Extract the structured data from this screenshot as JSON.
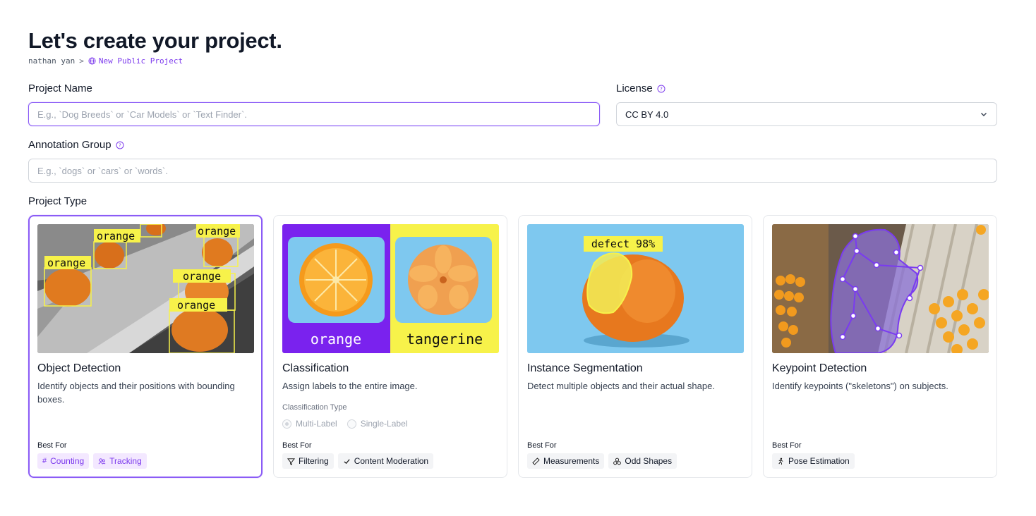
{
  "page": {
    "title": "Let's create your project.",
    "breadcrumb": {
      "user": "nathan yan",
      "separator": ">",
      "project": "New Public Project"
    }
  },
  "form": {
    "project_name": {
      "label": "Project Name",
      "placeholder": "E.g., `Dog Breeds` or `Car Models` or `Text Finder`."
    },
    "license": {
      "label": "License",
      "value": "CC BY 4.0"
    },
    "annotation_group": {
      "label": "Annotation Group",
      "placeholder": "E.g., `dogs` or `cars` or `words`."
    },
    "project_type_label": "Project Type"
  },
  "cards": {
    "object_detection": {
      "title": "Object Detection",
      "desc": "Identify objects and their positions with bounding boxes.",
      "best_for": "Best For",
      "tags": [
        "Counting",
        "Tracking"
      ],
      "img_labels": [
        "orange",
        "orange",
        "orange",
        "orange",
        "orange"
      ]
    },
    "classification": {
      "title": "Classification",
      "desc": "Assign labels to the entire image.",
      "type_label": "Classification Type",
      "options": [
        "Multi-Label",
        "Single-Label"
      ],
      "best_for": "Best For",
      "tags": [
        "Filtering",
        "Content Moderation"
      ],
      "img_labels": [
        "orange",
        "tangerine"
      ]
    },
    "instance_segmentation": {
      "title": "Instance Segmentation",
      "desc": "Detect multiple objects and their actual shape.",
      "best_for": "Best For",
      "tags": [
        "Measurements",
        "Odd Shapes"
      ],
      "img_label": "defect 98%"
    },
    "keypoint_detection": {
      "title": "Keypoint Detection",
      "desc": "Identify keypoints (\"skeletons\") on subjects.",
      "best_for": "Best For",
      "tags": [
        "Pose Estimation"
      ]
    }
  },
  "colors": {
    "accent": "#8b5cf6",
    "accent_dark": "#7c3aed",
    "label_yellow": "#f7f24a",
    "sky": "#7ec8ef"
  },
  "icons": [
    "globe-icon",
    "help-circle-icon",
    "chevron-down-icon",
    "hash-icon",
    "users-icon",
    "filter-icon",
    "check-icon",
    "ruler-icon",
    "shapes-icon",
    "person-icon"
  ]
}
